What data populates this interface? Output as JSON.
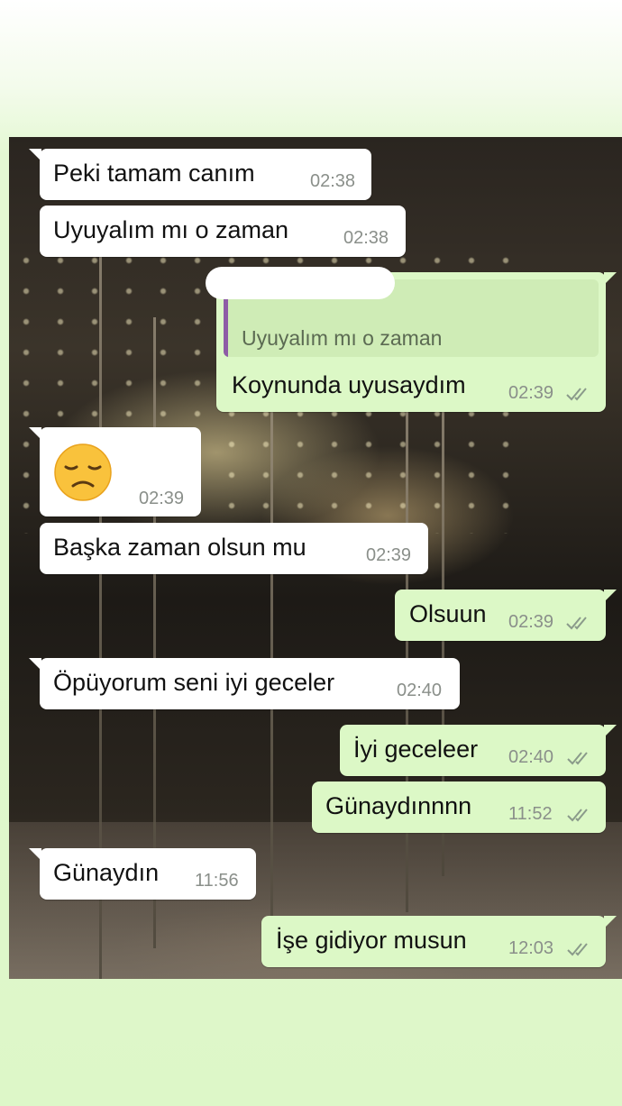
{
  "colors": {
    "incoming_bubble": "#ffffff",
    "outgoing_bubble": "#dcf8c6",
    "quote_accent": "#8e5ca6",
    "read_ticks": "#8a9a8a"
  },
  "messages": [
    {
      "direction": "in",
      "text": "Peki tamam canım",
      "time": "02:38"
    },
    {
      "direction": "in",
      "text": "Uyuyalım mı o zaman",
      "time": "02:38"
    },
    {
      "direction": "out",
      "quote": "Uyuyalım mı o zaman",
      "text": "Koynunda uyusaydım",
      "time": "02:39",
      "status_icon": "double-check-icon"
    },
    {
      "direction": "in",
      "emoji": "😞",
      "emoji_name": "disappointed-face-emoji",
      "time": "02:39"
    },
    {
      "direction": "in",
      "text": "Başka zaman olsun mu",
      "time": "02:39"
    },
    {
      "direction": "out",
      "text": "Olsuun",
      "time": "02:39",
      "status_icon": "double-check-icon"
    },
    {
      "direction": "in",
      "text": "Öpüyorum seni iyi geceler",
      "time": "02:40"
    },
    {
      "direction": "out",
      "text": "İyi geceleer",
      "time": "02:40",
      "status_icon": "double-check-icon"
    },
    {
      "direction": "out",
      "text": "Günaydınnnn",
      "time": "11:52",
      "status_icon": "double-check-icon"
    },
    {
      "direction": "in",
      "text": "Günaydın",
      "time": "11:56"
    },
    {
      "direction": "out",
      "text": "İşe gidiyor musun",
      "time": "12:03",
      "status_icon": "double-check-icon"
    }
  ]
}
